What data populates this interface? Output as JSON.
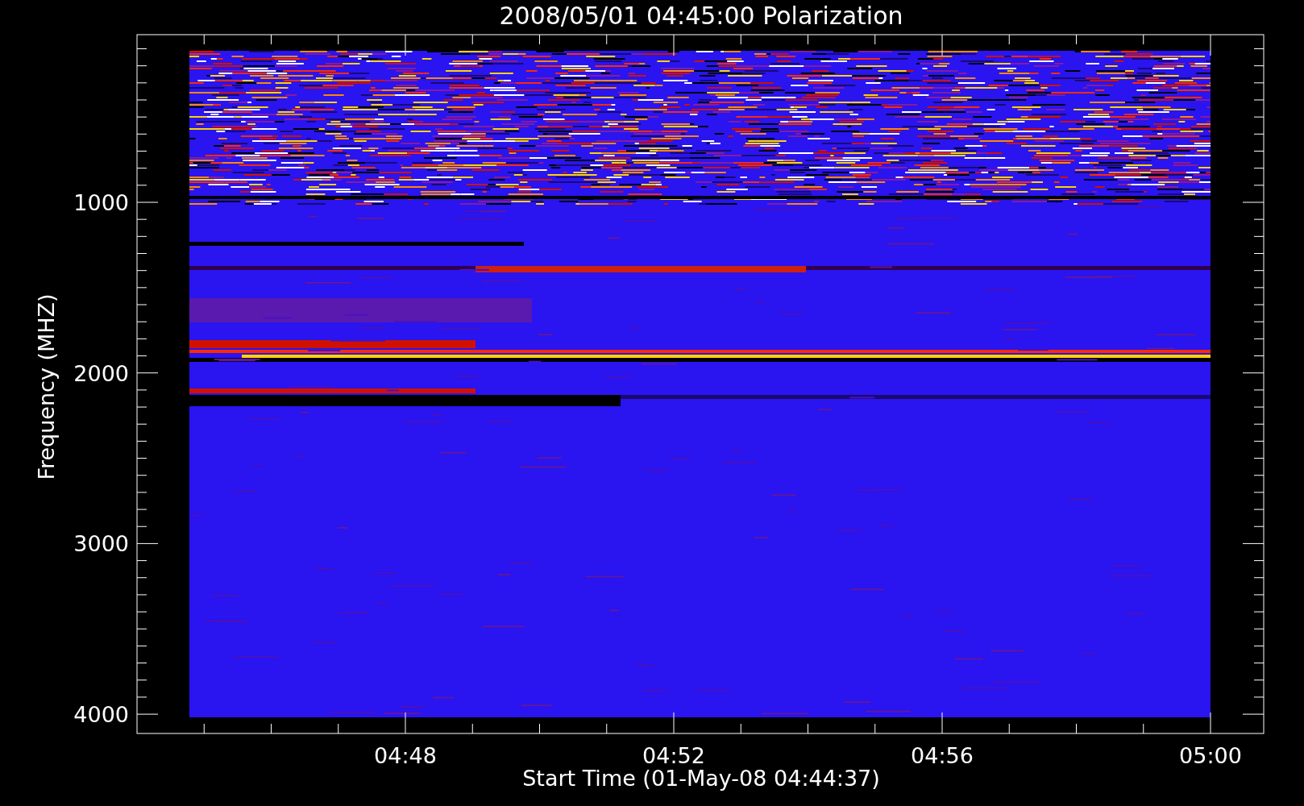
{
  "plot": {
    "title": "2008/05/01 04:45:00 Polarization",
    "xlabel": "Start Time (01-May-08 04:44:37)",
    "ylabel": "Frequency (MHZ)",
    "yticks": [
      "1000",
      "2000",
      "3000",
      "4000"
    ],
    "xticks": [
      "04:48",
      "04:52",
      "04:56",
      "05:00"
    ]
  }
}
